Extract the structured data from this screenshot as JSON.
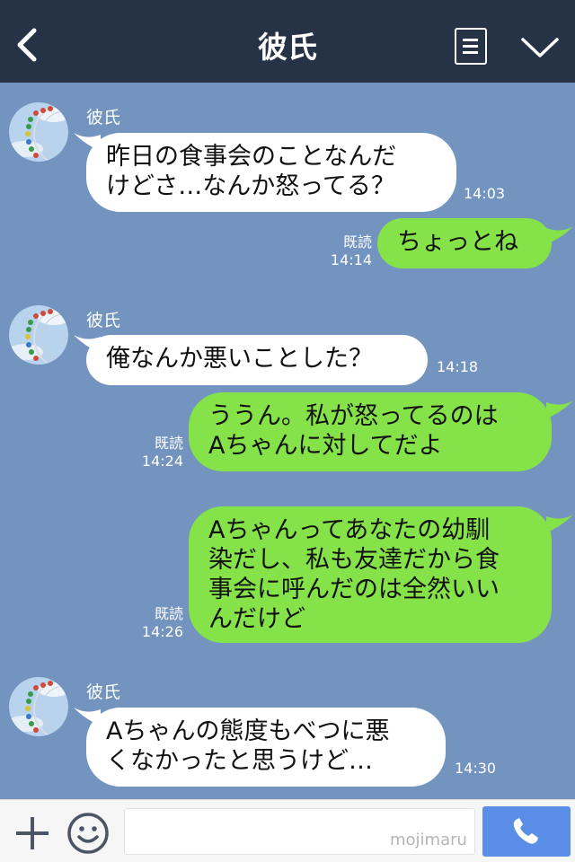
{
  "header": {
    "title": "彼氏"
  },
  "icons": {
    "back": "chevron-left-icon",
    "menu": "menu-icon",
    "collapse": "chevron-down-icon",
    "add": "plus-icon",
    "sticker": "smiley-icon",
    "call": "phone-icon"
  },
  "colors": {
    "header_bg": "#263246",
    "chat_bg": "#7494c0",
    "outgoing_bubble": "#85e249",
    "incoming_bubble": "#ffffff",
    "call_button": "#5b8ee6"
  },
  "messages": [
    {
      "direction": "in",
      "sender": "彼氏",
      "lines": [
        "昨日の食事会のことなんだ",
        "けどさ…なんか怒ってる？"
      ],
      "time": "14:03"
    },
    {
      "direction": "out",
      "read": "既読",
      "lines": [
        "ちょっとね"
      ],
      "time": "14:14"
    },
    {
      "direction": "in",
      "sender": "彼氏",
      "lines": [
        "俺なんか悪いことした？"
      ],
      "time": "14:18"
    },
    {
      "direction": "out",
      "read": "既読",
      "lines": [
        "ううん。私が怒ってるのは",
        "Aちゃんに対してだよ"
      ],
      "time": "14:24"
    },
    {
      "direction": "out",
      "read": "既読",
      "lines": [
        "Aちゃんってあなたの幼馴",
        "染だし、私も友達だから食",
        "事会に呼んだのは全然いい",
        "んだけど"
      ],
      "time": "14:26"
    },
    {
      "direction": "in",
      "sender": "彼氏",
      "lines": [
        "Aちゃんの態度もべつに悪",
        "くなかったと思うけど…"
      ],
      "time": "14:30"
    }
  ],
  "input": {
    "value": "",
    "watermark": "mojimaru"
  }
}
